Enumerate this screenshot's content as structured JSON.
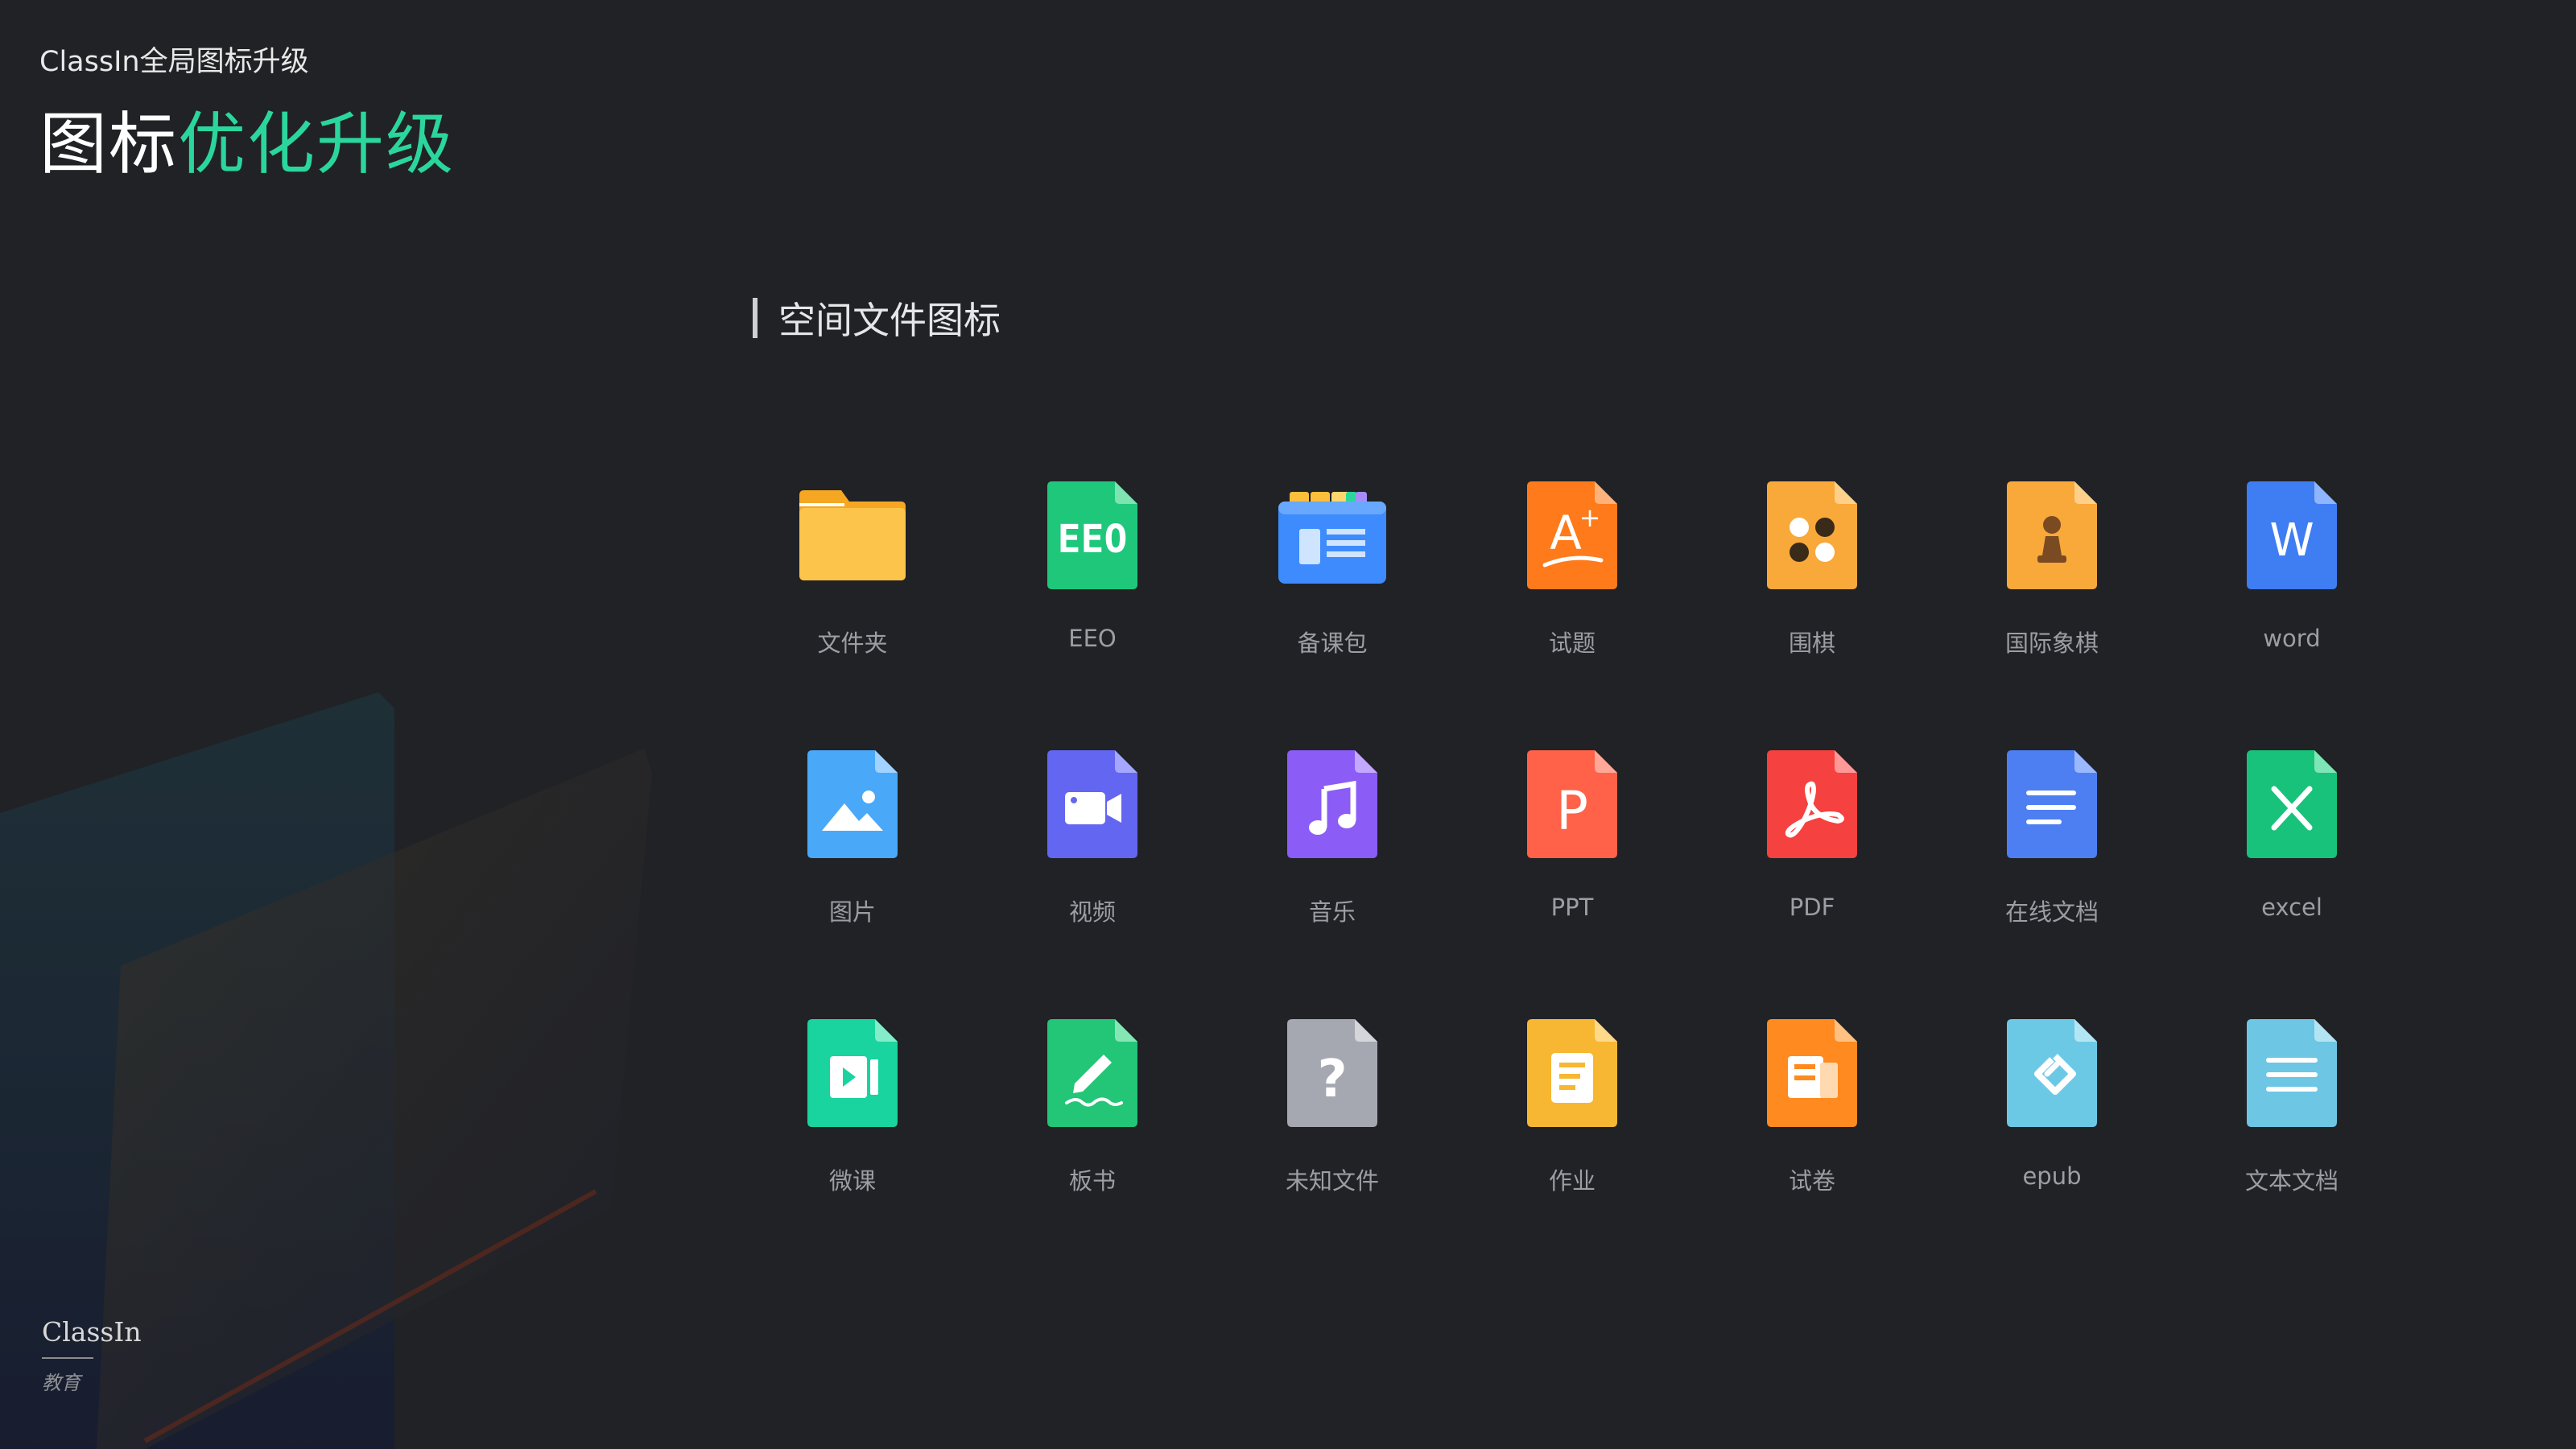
{
  "header": {
    "subtitle": "ClassIn全局图标升级",
    "title_white": "图标",
    "title_green": "优化升级"
  },
  "section": {
    "title": "空间文件图标"
  },
  "icons": [
    {
      "label": "文件夹",
      "icon": "folder-icon",
      "color": "#fbbf3c"
    },
    {
      "label": "EEO",
      "icon": "eeo-icon",
      "color": "#1fc77b"
    },
    {
      "label": "备课包",
      "icon": "lesson-package-icon",
      "color": "#3d8bfd"
    },
    {
      "label": "试题",
      "icon": "test-question-icon",
      "color": "#ff7a1a"
    },
    {
      "label": "围棋",
      "icon": "go-game-icon",
      "color": "#f9a83a"
    },
    {
      "label": "国际象棋",
      "icon": "chess-icon",
      "color": "#f9a83a"
    },
    {
      "label": "word",
      "icon": "word-icon",
      "color": "#3f7df3"
    },
    {
      "label": "图片",
      "icon": "image-icon",
      "color": "#4aa8f8"
    },
    {
      "label": "视频",
      "icon": "video-icon",
      "color": "#6366f1"
    },
    {
      "label": "音乐",
      "icon": "music-icon",
      "color": "#8b5cf6"
    },
    {
      "label": "PPT",
      "icon": "ppt-icon",
      "color": "#ff6248"
    },
    {
      "label": "PDF",
      "icon": "pdf-icon",
      "color": "#f5413f"
    },
    {
      "label": "在线文档",
      "icon": "online-doc-icon",
      "color": "#4d7ff2"
    },
    {
      "label": "excel",
      "icon": "excel-icon",
      "color": "#18c27a"
    },
    {
      "label": "微课",
      "icon": "micro-lesson-icon",
      "color": "#19d49e"
    },
    {
      "label": "板书",
      "icon": "blackboard-writing-icon",
      "color": "#23c576"
    },
    {
      "label": "未知文件",
      "icon": "unknown-file-icon",
      "color": "#a6a8b1"
    },
    {
      "label": "作业",
      "icon": "homework-icon",
      "color": "#f7b733"
    },
    {
      "label": "试卷",
      "icon": "exam-paper-icon",
      "color": "#ff8a1f"
    },
    {
      "label": "epub",
      "icon": "epub-icon",
      "color": "#6cc9e6"
    },
    {
      "label": "文本文档",
      "icon": "text-doc-icon",
      "color": "#6cc6e4"
    }
  ],
  "brand": {
    "name": "ClassIn",
    "sub": "教育"
  }
}
